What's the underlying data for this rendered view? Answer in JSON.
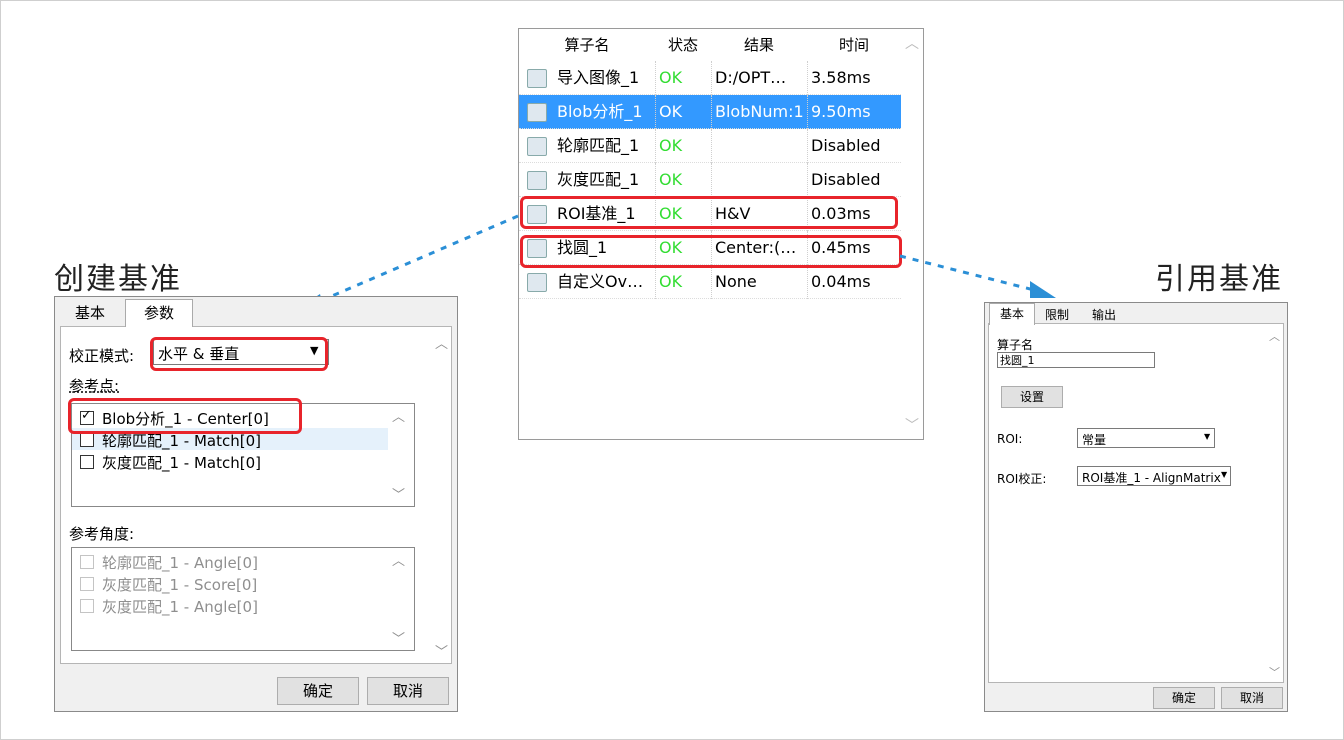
{
  "colors": {
    "selection": "#3399ff",
    "ok_text": "#33dd33",
    "highlight": "#e8242b",
    "arrow": "#2b8fd6"
  },
  "captions": {
    "create": "创建基准",
    "reference": "引用基准"
  },
  "operator_table": {
    "columns": [
      "算子名",
      "状态",
      "结果",
      "时间"
    ],
    "rows": [
      {
        "name": "导入图像_1",
        "status": "OK",
        "result": "D:/OPT…",
        "time": "3.58ms",
        "icon": "image-import-icon"
      },
      {
        "name": "Blob分析_1",
        "status": "OK",
        "result": "BlobNum:1",
        "time": "9.50ms",
        "icon": "blob-icon",
        "selected": true
      },
      {
        "name": "轮廓匹配_1",
        "status": "OK",
        "result": "",
        "time": "Disabled",
        "icon": "contour-match-icon"
      },
      {
        "name": "灰度匹配_1",
        "status": "OK",
        "result": "",
        "time": "Disabled",
        "icon": "gray-match-icon"
      },
      {
        "name": "ROI基准_1",
        "status": "OK",
        "result": "H&V",
        "time": "0.03ms",
        "icon": "roi-icon"
      },
      {
        "name": "找圆_1",
        "status": "OK",
        "result": "Center:(…",
        "time": "0.45ms",
        "icon": "circle-icon"
      },
      {
        "name": "自定义Ov…",
        "status": "OK",
        "result": "None",
        "time": "0.04ms",
        "icon": "overlay-icon"
      }
    ]
  },
  "create_dialog": {
    "tabs": [
      "基本",
      "参数"
    ],
    "mode_label": "校正模式:",
    "mode_value": "水平 & 垂直",
    "ref_points_label": "参考点:",
    "ref_points": [
      {
        "label": "Blob分析_1 - Center[0]",
        "checked": true
      },
      {
        "label": "轮廓匹配_1 - Match[0]",
        "checked": false
      },
      {
        "label": "灰度匹配_1 - Match[0]",
        "checked": false
      }
    ],
    "ref_angle_label": "参考角度:",
    "ref_angles": [
      {
        "label": "轮廓匹配_1 - Angle[0]",
        "checked": false
      },
      {
        "label": "灰度匹配_1 - Score[0]",
        "checked": false
      },
      {
        "label": "灰度匹配_1 - Angle[0]",
        "checked": false
      }
    ],
    "ok": "确定",
    "cancel": "取消"
  },
  "ref_dialog": {
    "tabs": [
      "基本",
      "限制",
      "输出"
    ],
    "name_label": "算子名",
    "name_value": "找圆_1",
    "settings_button": "设置",
    "roi_label": "ROI:",
    "roi_value": "常量",
    "roi_corr_label": "ROI校正:",
    "roi_corr_value": "ROI基准_1 - AlignMatrix",
    "ok": "确定",
    "cancel": "取消"
  }
}
